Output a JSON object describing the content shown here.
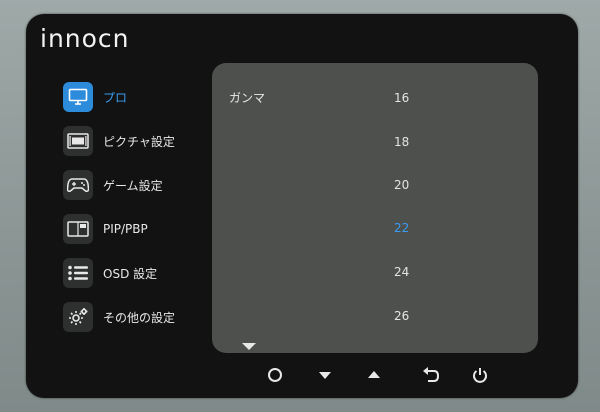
{
  "brand": {
    "logo": "innocn"
  },
  "menu": {
    "items": [
      {
        "label": "プロ",
        "icon": "monitor-icon",
        "active": true
      },
      {
        "label": "ピクチャ設定",
        "icon": "picture-icon",
        "active": false
      },
      {
        "label": "ゲーム設定",
        "icon": "gamepad-icon",
        "active": false
      },
      {
        "label": "PIP/PBP",
        "icon": "pip-icon",
        "active": false
      },
      {
        "label": "OSD 設定",
        "icon": "list-icon",
        "active": false
      },
      {
        "label": "その他の設定",
        "icon": "gear-icon",
        "active": false
      }
    ]
  },
  "panel": {
    "parameter": "ガンマ",
    "options": [
      "16",
      "18",
      "20",
      "22",
      "24",
      "26"
    ],
    "selected": "22",
    "more_below": true
  },
  "navbar": {
    "buttons": [
      "circle-icon",
      "arrow-down-icon",
      "arrow-up-icon",
      "back-icon",
      "power-icon"
    ]
  },
  "colors": {
    "accent": "#2d8bdc",
    "accent_text": "#3a9cf0",
    "osd_bg": "#111211",
    "panel_bg": "#4e504d"
  }
}
